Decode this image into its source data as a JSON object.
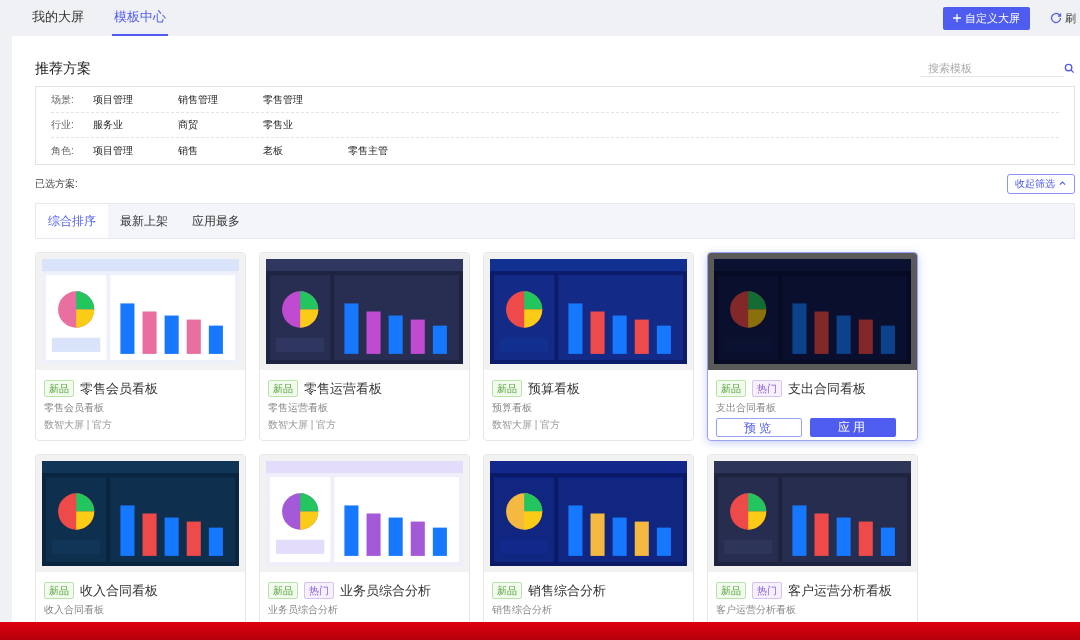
{
  "top_tabs": [
    {
      "label": "我的大屏",
      "selected": false
    },
    {
      "label": "模板中心",
      "selected": true
    }
  ],
  "create_button": "自定义大屏",
  "refresh_button": "刷",
  "section_title": "推荐方案",
  "search": {
    "placeholder": "搜索模板"
  },
  "filters": [
    {
      "label": "场景:",
      "options": [
        "项目管理",
        "销售管理",
        "零售管理"
      ]
    },
    {
      "label": "行业:",
      "options": [
        "服务业",
        "商贸",
        "零售业"
      ]
    },
    {
      "label": "角色:",
      "options": [
        "项目管理",
        "销售",
        "老板",
        "零售主管"
      ]
    }
  ],
  "selected_label": "已选方案:",
  "collapse_button": "收起筛选",
  "sort_tabs": [
    {
      "label": "综合排序",
      "selected": true
    },
    {
      "label": "最新上架",
      "selected": false
    },
    {
      "label": "应用最多",
      "selected": false
    }
  ],
  "cards": [
    {
      "tags": [
        {
          "label": "新品",
          "kind": "new"
        }
      ],
      "title": "零售会员看板",
      "subtitle": "零售会员看板",
      "source": "数智大屏 | 官方",
      "hovered": false
    },
    {
      "tags": [
        {
          "label": "新品",
          "kind": "new"
        }
      ],
      "title": "零售运营看板",
      "subtitle": "零售运营看板",
      "source": "数智大屏 | 官方",
      "hovered": false
    },
    {
      "tags": [
        {
          "label": "新品",
          "kind": "new"
        }
      ],
      "title": "预算看板",
      "subtitle": "预算看板",
      "source": "数智大屏 | 官方",
      "hovered": false
    },
    {
      "tags": [
        {
          "label": "新品",
          "kind": "new"
        },
        {
          "label": "热门",
          "kind": "hot"
        }
      ],
      "title": "支出合同看板",
      "subtitle": "支出合同看板",
      "hovered": true,
      "actions": [
        "预览",
        "应用"
      ]
    },
    {
      "tags": [
        {
          "label": "新品",
          "kind": "new"
        }
      ],
      "title": "收入合同看板",
      "subtitle": "收入合同看板",
      "hovered": false
    },
    {
      "tags": [
        {
          "label": "新品",
          "kind": "new"
        },
        {
          "label": "热门",
          "kind": "hot"
        }
      ],
      "title": "业务员综合分析",
      "subtitle": "业务员综合分析",
      "hovered": false
    },
    {
      "tags": [
        {
          "label": "新品",
          "kind": "new"
        }
      ],
      "title": "销售综合分析",
      "subtitle": "销售综合分析",
      "hovered": false
    },
    {
      "tags": [
        {
          "label": "新品",
          "kind": "new"
        },
        {
          "label": "热门",
          "kind": "hot"
        }
      ],
      "title": "客户运营分析看板",
      "subtitle": "客户运营分析看板",
      "hovered": false
    }
  ]
}
